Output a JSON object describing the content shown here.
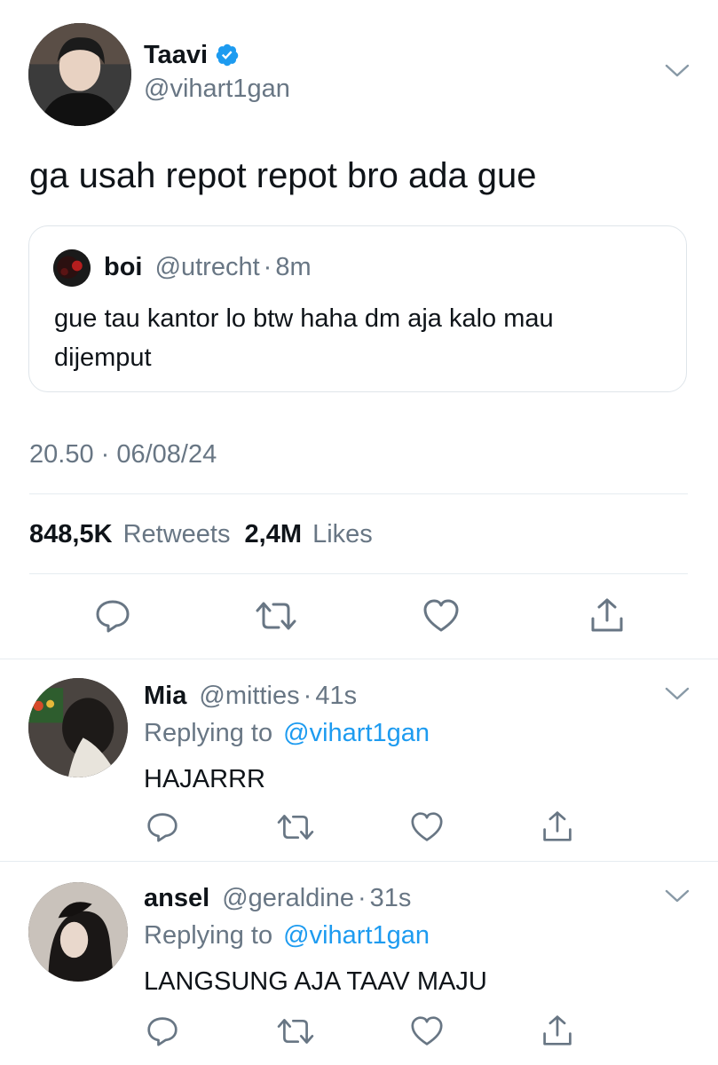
{
  "tweet": {
    "author": {
      "name": "Taavi",
      "handle": "@vihart1gan",
      "verified": true
    },
    "text": "ga usah repot repot bro ada gue",
    "quoted": {
      "name": "boi",
      "handle": "@utrecht",
      "sep": "·",
      "time": "8m",
      "text_line1": "gue tau kantor lo btw haha dm aja kalo mau",
      "text_line2": "dijemput"
    },
    "timestamp": "20.50 · 06/08/24",
    "stats": {
      "retweets_count": "848,5K",
      "retweets_label": "Retweets",
      "likes_count": "2,4M",
      "likes_label": "Likes"
    }
  },
  "replies": [
    {
      "name": "Mia",
      "handle": "@mitties",
      "sep": "·",
      "time": "41s",
      "replying_label": "Replying to",
      "replying_to": "@vihart1gan",
      "text": "HAJARRR"
    },
    {
      "name": "ansel",
      "handle": "@geraldine",
      "sep": "·",
      "time": "31s",
      "replying_label": "Replying to",
      "replying_to": "@vihart1gan",
      "text": "LANGSUNG AJA TAAV MAJU"
    }
  ],
  "icons": {
    "verified": "verified-badge-icon",
    "more": "chevron-down-icon",
    "reply": "reply-icon",
    "retweet": "retweet-icon",
    "like": "heart-icon",
    "share": "share-icon"
  },
  "colors": {
    "accent": "#1d9bf0",
    "secondary_text": "#687684",
    "divider": "#e6ecf0"
  }
}
